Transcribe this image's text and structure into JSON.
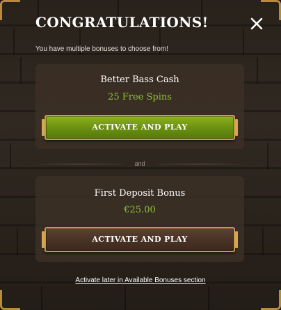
{
  "modal": {
    "title": "CONGRATULATIONS!",
    "subtitle": "You have multiple bonuses to choose from!",
    "close_icon": "close-icon"
  },
  "bonuses": [
    {
      "name": "Better Bass Cash",
      "value": "25 Free Spins",
      "button_label": "ACTIVATE AND PLAY",
      "button_color": "#6f9412"
    },
    {
      "name": "First Deposit Bonus",
      "value": "€25.00",
      "button_label": "ACTIVATE AND PLAY",
      "button_color": "#4a3326"
    }
  ],
  "separator": {
    "label": "and"
  },
  "footer": {
    "link_label": "Activate later in Available Bonuses section"
  },
  "colors": {
    "accent_green": "#8cc23a",
    "gold_border": "#c99a47",
    "text": "#ffffff"
  }
}
